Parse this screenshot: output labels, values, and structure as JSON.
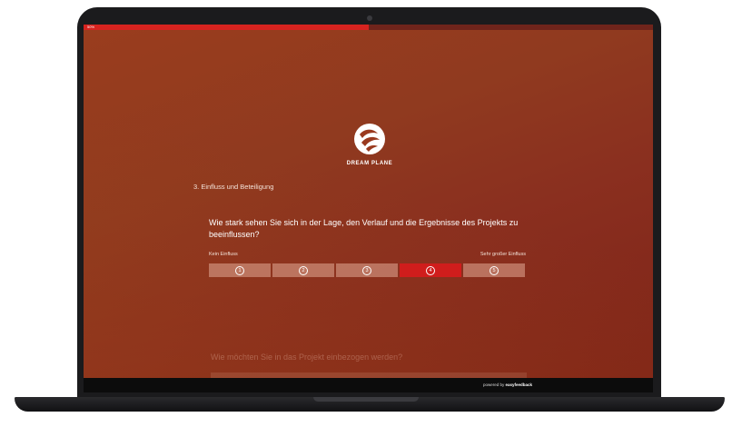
{
  "survey": {
    "progress_label": "50%",
    "progress_value": 0.5,
    "brand": "DREAM PLANE",
    "section_title": "3. Einfluss und Beteiligung",
    "question": "Wie stark sehen Sie sich in der Lage, den Verlauf und die Ergebnisse des Projekts zu beeinflussen?",
    "scale_min_label": "Kein Einfluss",
    "scale_max_label": "Sehr großer Einfluss",
    "options": [
      "1",
      "2",
      "3",
      "4",
      "5"
    ],
    "selected_option": "4",
    "next_question": "Wie möchten Sie in das Projekt einbezogen werden?"
  },
  "footer": {
    "powered_prefix": "powered by",
    "powered_brand": "easyfeedback"
  },
  "colors": {
    "accent": "#d01d1c",
    "background": "#8f351e"
  }
}
